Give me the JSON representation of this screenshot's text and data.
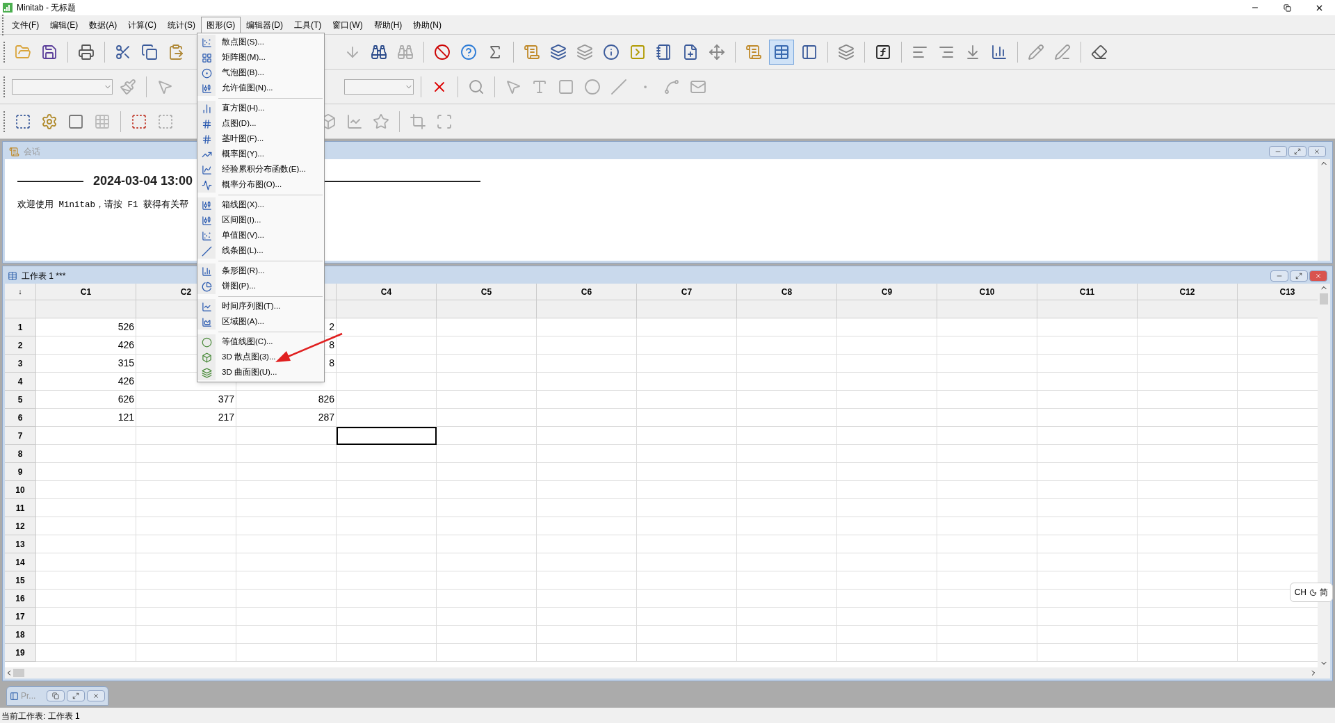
{
  "window": {
    "title": "Minitab - 无标题"
  },
  "menu_bar": [
    {
      "label": "文件(F)",
      "selected": false
    },
    {
      "label": "编辑(E)",
      "selected": false
    },
    {
      "label": "数据(A)",
      "selected": false
    },
    {
      "label": "计算(C)",
      "selected": false
    },
    {
      "label": "统计(S)",
      "selected": false
    },
    {
      "label": "图形(G)",
      "selected": true
    },
    {
      "label": "编辑器(D)",
      "selected": false
    },
    {
      "label": "工具(T)",
      "selected": false
    },
    {
      "label": "窗口(W)",
      "selected": false
    },
    {
      "label": "帮助(H)",
      "selected": false
    },
    {
      "label": "协助(N)",
      "selected": false
    }
  ],
  "graph_menu": {
    "groups": [
      [
        "散点图(S)...",
        "矩阵图(M)...",
        "气泡图(B)...",
        "允许值图(N)..."
      ],
      [
        "直方图(H)...",
        "点图(D)...",
        "茎叶图(F)...",
        "概率图(Y)...",
        "经验累积分布函数(E)...",
        "概率分布图(O)..."
      ],
      [
        "箱线图(X)...",
        "区间图(I)...",
        "单值图(V)...",
        "线条图(L)..."
      ],
      [
        "条形图(R)...",
        "饼图(P)..."
      ],
      [
        "时间序列图(T)...",
        "区域图(A)..."
      ],
      [
        "等值线图(C)...",
        "3D 散点图(3)...",
        "3D 曲面图(U)..."
      ]
    ]
  },
  "session": {
    "title": "会话",
    "date": "2024-03-04 13:00",
    "welcome": "欢迎使用 Minitab，请按 F1 获得有关帮"
  },
  "worksheet": {
    "title": "工作表 1 ***",
    "corner": "↓",
    "columns": [
      {
        "label": "C1"
      },
      {
        "label": "C2"
      },
      {},
      {
        "label": "C4"
      },
      {
        "label": "C5"
      },
      {
        "label": "C6"
      },
      {
        "label": "C7"
      },
      {
        "label": "C8"
      },
      {
        "label": "C9"
      },
      {
        "label": "C10"
      },
      {
        "label": "C11"
      },
      {
        "label": "C12"
      },
      {
        "label": "C13"
      }
    ],
    "rows": [
      {
        "number": "1",
        "c1": "526",
        "c3": "2",
        "cursor": false
      },
      {
        "number": "2",
        "c1": "426",
        "c3": "8",
        "cursor": false
      },
      {
        "number": "3",
        "c1": "315",
        "c3": "8",
        "cursor": false
      },
      {
        "number": "4",
        "c1": "426",
        "cursor": false
      },
      {
        "number": "5",
        "c1": "626",
        "c2": "377",
        "c3": "826",
        "cursor": false
      },
      {
        "number": "6",
        "c1": "121",
        "c2": "217",
        "c3": "287",
        "cursor": false
      },
      {
        "number": "7",
        "cursor": true
      },
      {
        "number": "8",
        "cursor": false
      },
      {
        "number": "9",
        "cursor": false
      },
      {
        "number": "10",
        "cursor": false
      },
      {
        "number": "11",
        "cursor": false
      },
      {
        "number": "12",
        "cursor": false
      },
      {
        "number": "13",
        "cursor": false
      },
      {
        "number": "14",
        "cursor": false
      },
      {
        "number": "15",
        "cursor": false
      },
      {
        "number": "16",
        "cursor": false
      },
      {
        "number": "17",
        "cursor": false
      },
      {
        "number": "18",
        "cursor": false
      },
      {
        "number": "19",
        "cursor": false
      }
    ]
  },
  "minimized_window": {
    "title": "Pr..."
  },
  "status_bar": {
    "text": "当前工作表: 工作表 1"
  },
  "ime_indicator": {
    "language": "CH",
    "mode": "简"
  }
}
